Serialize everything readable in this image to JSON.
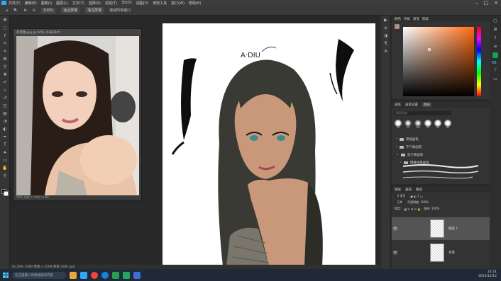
{
  "app": {
    "name": "Photoshop"
  },
  "menubar": {
    "items": [
      "文件(F)",
      "编辑(E)",
      "图像(I)",
      "图层(L)",
      "文字(Y)",
      "选择(S)",
      "滤镜(T)",
      "3D(D)",
      "视图(V)",
      "增效工具",
      "窗口(W)",
      "帮助(H)"
    ]
  },
  "options": {
    "zoom_value": "100%",
    "fit_screen": "适合屏幕",
    "fill_screen": "填充屏幕",
    "scroll_all": "滚动所有窗口"
  },
  "reference_window": {
    "title": "参考图.jpg @ 50% (RGB/8#)",
    "footer": "50% 文档:3.24M/3.24M"
  },
  "canvas": {
    "signature": "A·DIU"
  },
  "status": {
    "zoom": "33.33%",
    "doc_info": "2480 像素 x 3508 像素 (300 ppi)"
  },
  "color_panel": {
    "tabs": [
      "颜色",
      "色板",
      "渐变",
      "图案"
    ],
    "fg_color": "#c49070"
  },
  "brush_panel": {
    "tabs": [
      "画笔",
      "画笔设置",
      "图层"
    ],
    "search_placeholder": "搜索画笔",
    "tip_sizes": [
      "30",
      "50",
      "100",
      "25",
      "50",
      "60"
    ],
    "folders": [
      "常规画笔",
      "干介质画笔",
      "湿介质画笔",
      "特殊效果画笔"
    ]
  },
  "layers_panel": {
    "tabs": [
      "图层",
      "通道",
      "路径"
    ],
    "filter_label": "Q 类型",
    "blend_mode": "正常",
    "opacity_label": "不透明度: 100%",
    "lock_label": "锁定:",
    "fill_label": "填充: 100%",
    "layers": [
      {
        "name": "图层 1"
      },
      {
        "name": "背景"
      }
    ]
  },
  "taskbar": {
    "search_placeholder": "在这里输入你要搜索的内容",
    "time": "22:21",
    "date": "2023/12/12"
  }
}
